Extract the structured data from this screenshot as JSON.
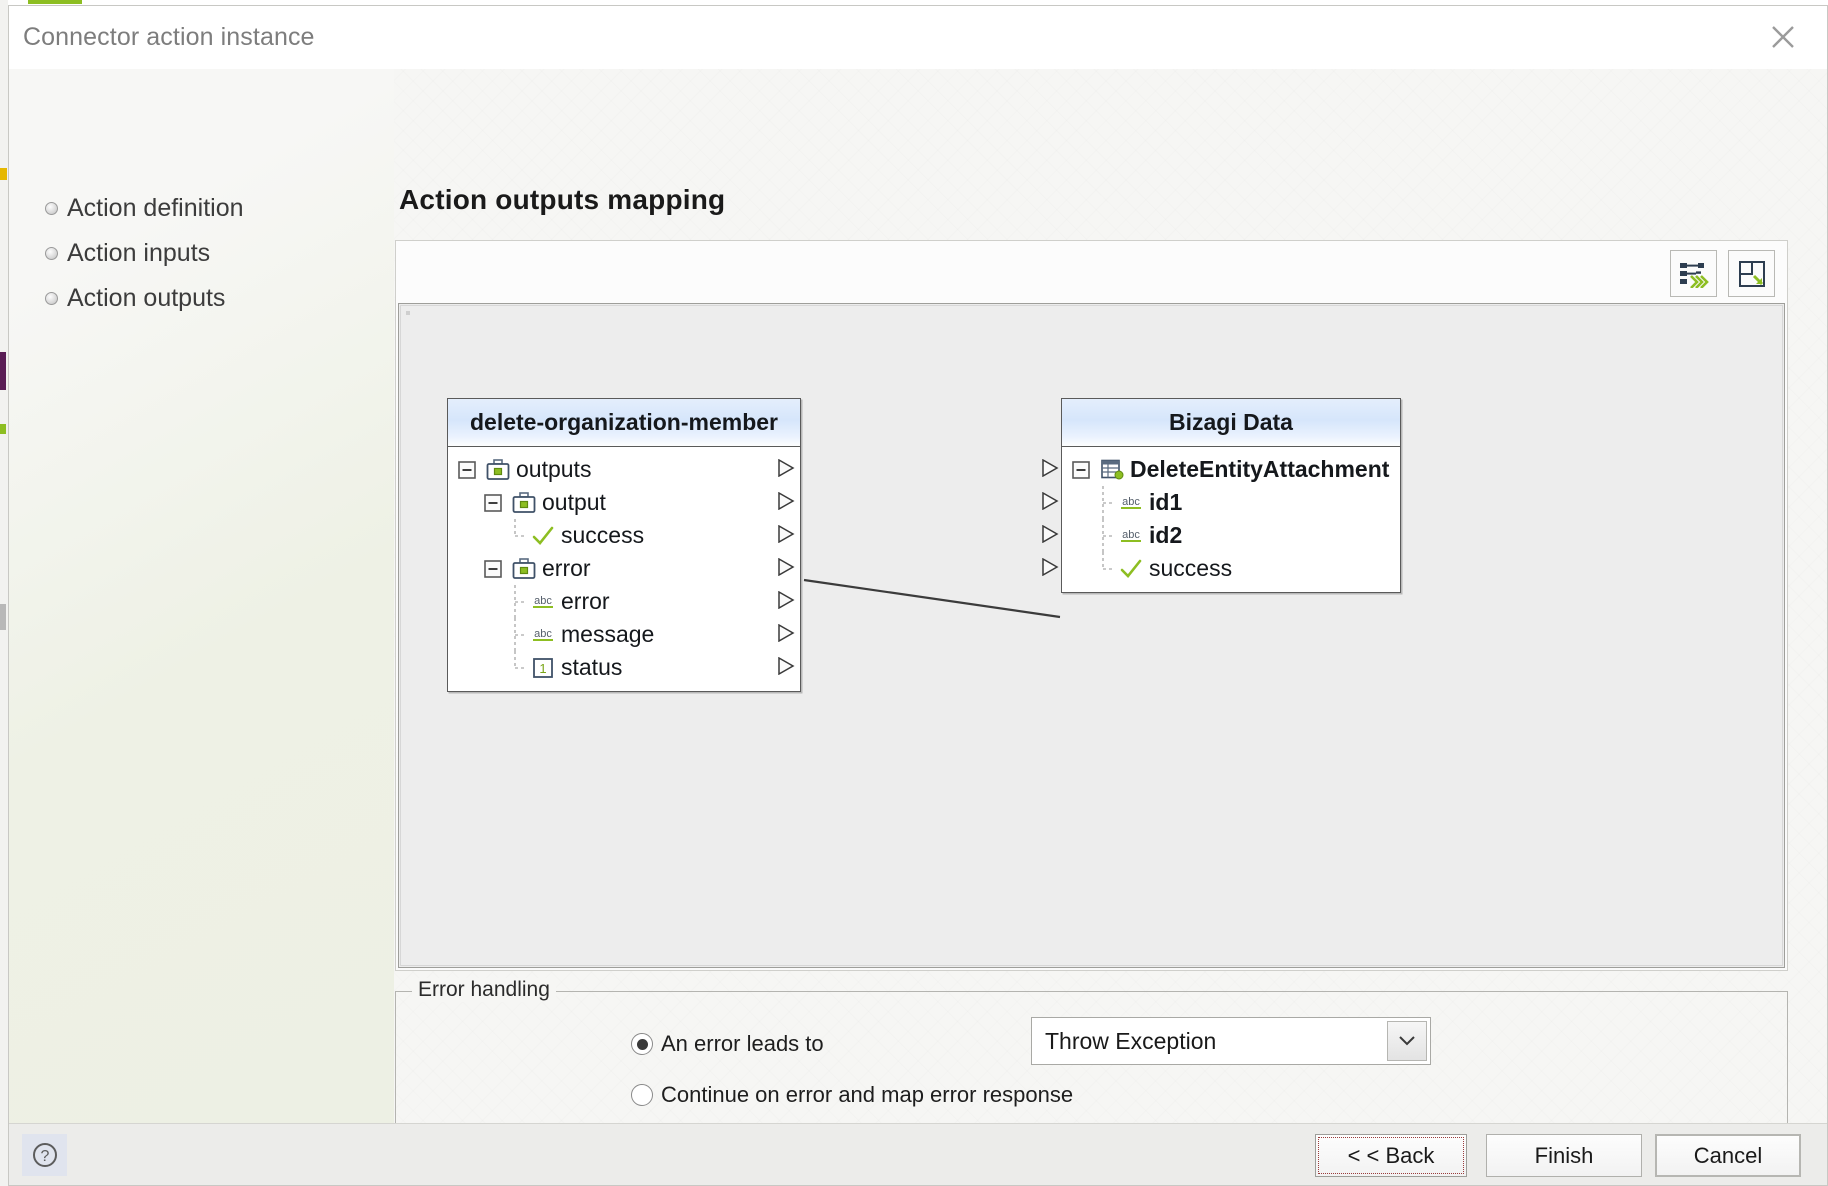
{
  "window": {
    "title": "Connector action instance",
    "close_icon": "close-icon"
  },
  "sidebar": {
    "items": [
      {
        "label": "Action definition"
      },
      {
        "label": "Action inputs"
      },
      {
        "label": "Action outputs"
      }
    ]
  },
  "main": {
    "page_title": "Action outputs mapping",
    "toolbar": [
      {
        "name": "auto-map-button",
        "icon": "auto-map-icon"
      },
      {
        "name": "fit-to-window-button",
        "icon": "fit-window-icon"
      }
    ]
  },
  "mapping": {
    "source_node": {
      "title": "delete-organization-member",
      "rows": [
        {
          "label": "outputs",
          "icon": "briefcase-icon",
          "indent": 0,
          "expander": "minus",
          "tree": "root",
          "port": true
        },
        {
          "label": "output",
          "icon": "briefcase-icon",
          "indent": 1,
          "expander": "minus",
          "tree": "mid",
          "port": true
        },
        {
          "label": "success",
          "icon": "check-icon",
          "indent": 2,
          "expander": "none",
          "tree": "last",
          "port": true
        },
        {
          "label": "error",
          "icon": "briefcase-icon",
          "indent": 1,
          "expander": "minus",
          "tree": "mid",
          "port": true
        },
        {
          "label": "error",
          "icon": "abc-icon",
          "indent": 2,
          "expander": "none",
          "tree": "branch",
          "port": true
        },
        {
          "label": "message",
          "icon": "abc-icon",
          "indent": 2,
          "expander": "none",
          "tree": "branch",
          "port": true
        },
        {
          "label": "status",
          "icon": "number-one-icon",
          "indent": 2,
          "expander": "none",
          "tree": "last",
          "port": true
        }
      ]
    },
    "target_node": {
      "title": "Bizagi Data",
      "rows": [
        {
          "label": "DeleteEntityAttachment",
          "icon": "entity-table-icon",
          "indent": 0,
          "expander": "minus",
          "tree": "root",
          "port": true,
          "bold": true
        },
        {
          "label": "id1",
          "icon": "abc-icon",
          "indent": 1,
          "expander": "none",
          "tree": "branch",
          "port": true,
          "bold": true
        },
        {
          "label": "id2",
          "icon": "abc-icon",
          "indent": 1,
          "expander": "none",
          "tree": "branch",
          "port": true,
          "bold": true
        },
        {
          "label": "success",
          "icon": "check-icon",
          "indent": 1,
          "expander": "none",
          "tree": "last",
          "port": true,
          "bold": false
        }
      ]
    },
    "links": [
      {
        "from": "success",
        "to": "success"
      }
    ]
  },
  "error_handling": {
    "legend": "Error handling",
    "option_leads_to": "An error leads to",
    "option_continue": "Continue on error and map error response",
    "selected": "An error leads to",
    "dropdown_value": "Throw Exception"
  },
  "footer": {
    "help_label": "?",
    "back_label": "< < Back",
    "finish_label": "Finish",
    "cancel_label": "Cancel"
  },
  "colors": {
    "accent_green": "#8dbe22",
    "header_blue": "#d6e6fb",
    "node_border": "#5a5a5a"
  }
}
